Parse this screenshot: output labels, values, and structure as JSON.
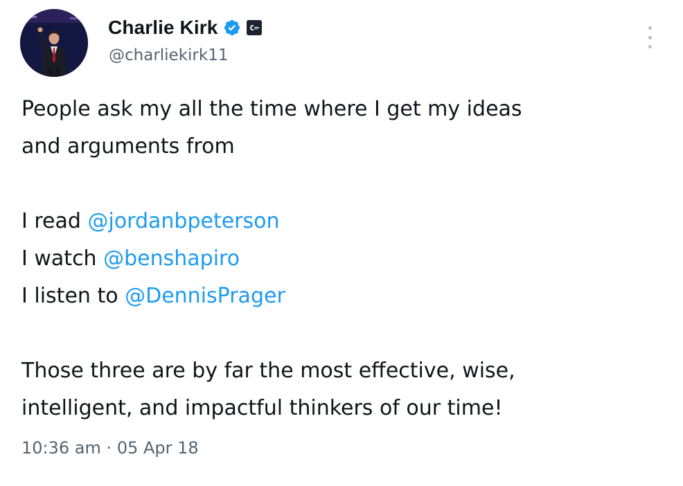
{
  "tweet": {
    "author": {
      "display_name": "Charlie Kirk",
      "handle": "@charliekirk11",
      "verified_icon": "verified-badge-icon",
      "affiliation_icon": "affiliation-badge-icon"
    },
    "more_icon": "more-options-icon",
    "text": {
      "line1": "People ask my all the time where I get my ideas",
      "line2": "and arguments from",
      "read_prefix": "I read ",
      "read_mention": "@jordanbpeterson",
      "watch_prefix": "I watch ",
      "watch_mention": "@benshapiro",
      "listen_prefix": "I listen to ",
      "listen_mention": "@DennisPrager",
      "closing1": "Those three are by far the most effective, wise,",
      "closing2": "intelligent, and impactful thinkers of our time!"
    },
    "time": "10:36 am",
    "separator": "·",
    "date": "05 Apr 18"
  },
  "colors": {
    "text": "#0f1419",
    "secondary": "#536471",
    "link": "#1d9bf0",
    "verified": "#1d9bf0"
  }
}
